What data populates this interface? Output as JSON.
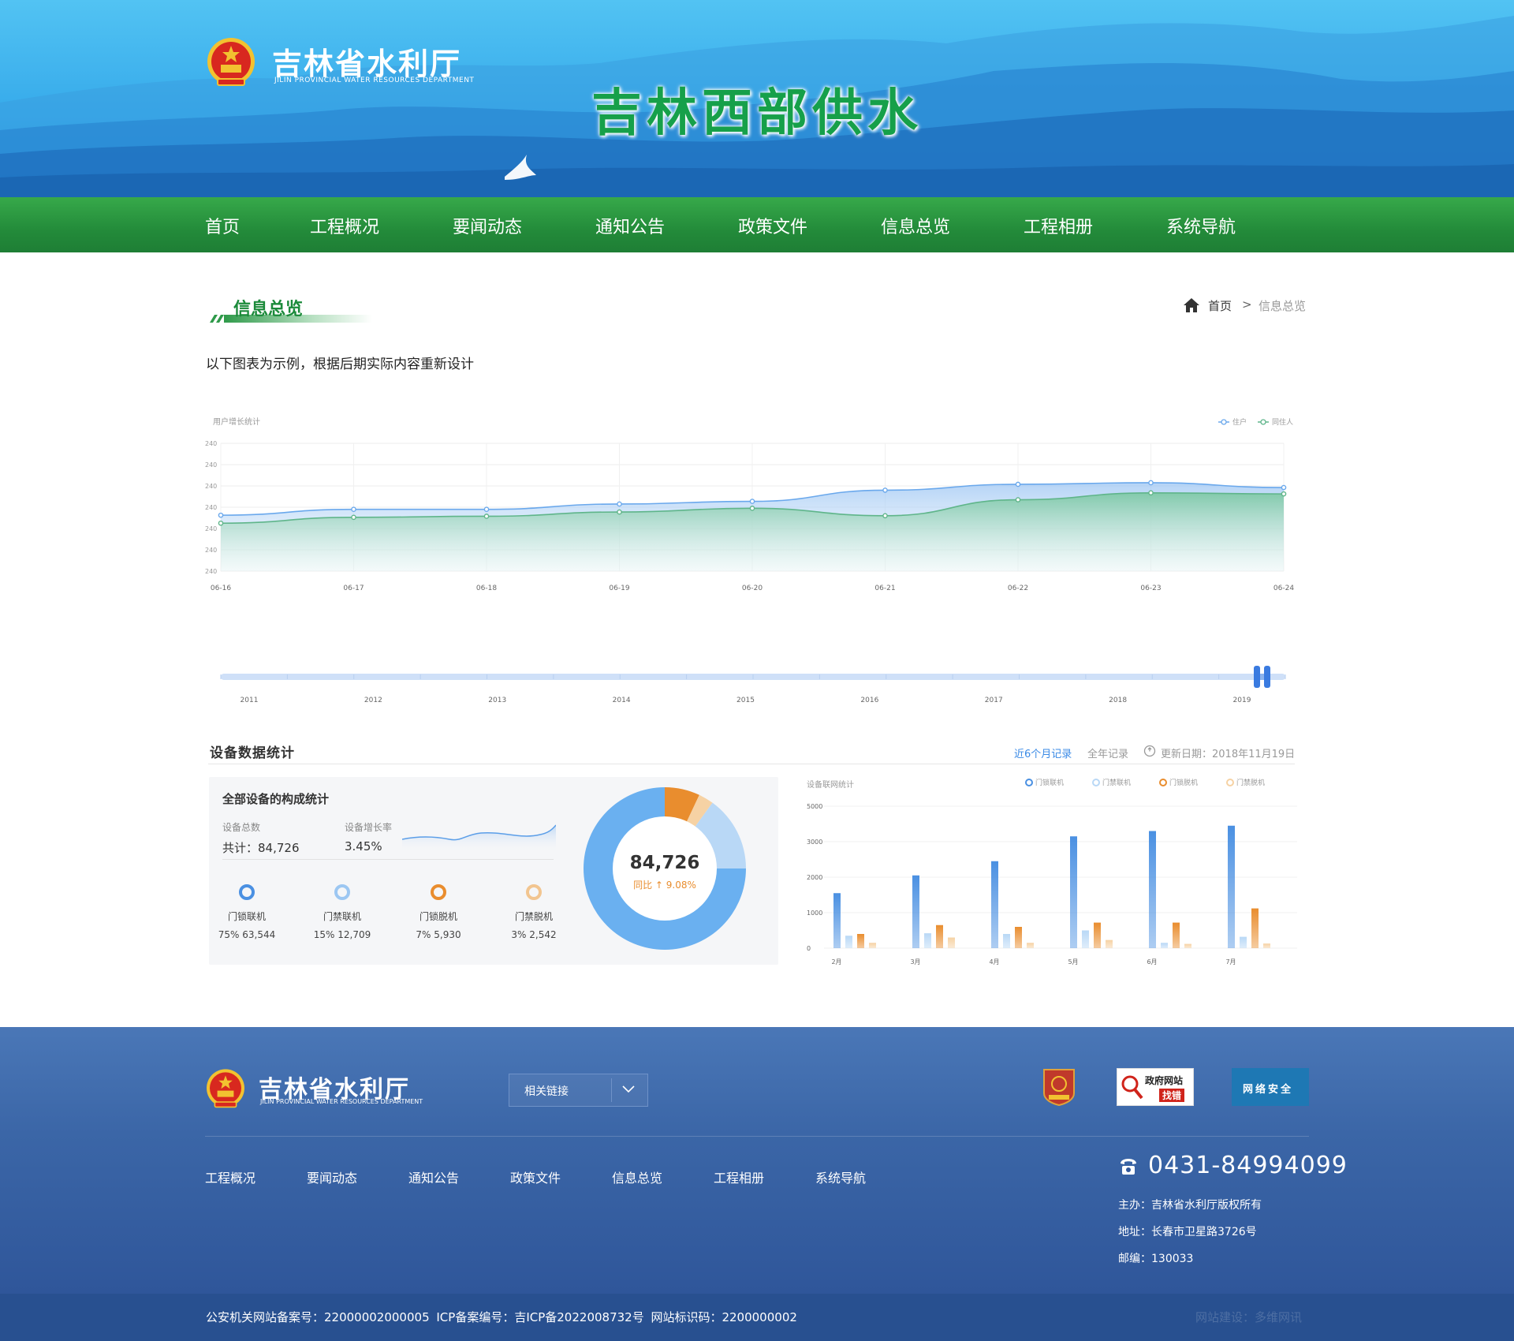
{
  "header": {
    "org_name": "吉林省水利厅",
    "org_name_en": "JILIN PROVINCIAL WATER RESOURCES DEPARTMENT",
    "site_title": "吉林西部供水"
  },
  "nav": {
    "items": [
      "首页",
      "工程概况",
      "要闻动态",
      "通知公告",
      "政策文件",
      "信息总览",
      "工程相册",
      "系统导航"
    ]
  },
  "page": {
    "section_title": "信息总览",
    "breadcrumb": {
      "home": "首页",
      "separator": ">",
      "current": "信息总览"
    },
    "intro": "以下图表为示例，根据后期实际内容重新设计"
  },
  "device_section": {
    "title": "设备数据统计",
    "tab_recent": "近6个月记录",
    "tab_year": "全年记录",
    "update_label": "更新日期：2018年11月19日",
    "card_title": "全部设备的构成统计",
    "total_label": "设备总数",
    "total_value": "共计：84,726",
    "growth_label": "设备增长率",
    "growth_value": "3.45%",
    "devices": [
      {
        "name": "门锁联机",
        "value": "75% 63,544",
        "color": "#4a90e2"
      },
      {
        "name": "门禁联机",
        "value": "15% 12,709",
        "color": "#9cc7f2"
      },
      {
        "name": "门锁脱机",
        "value": "7% 5,930",
        "color": "#e98d2e"
      },
      {
        "name": "门禁脱机",
        "value": "3% 2,542",
        "color": "#f2c590"
      }
    ],
    "donut_total": "84,726",
    "donut_sub": "同比 ↑ 9.08%"
  },
  "chart_data": [
    {
      "type": "area",
      "title": "用户增长统计",
      "categories": [
        "06-16",
        "06-17",
        "06-18",
        "06-19",
        "06-20",
        "06-21",
        "06-22",
        "06-23",
        "06-24"
      ],
      "y_tick_labels": [
        "240",
        "240",
        "240",
        "240",
        "240",
        "240",
        "240"
      ],
      "legend_placement": "top-right",
      "grid": true,
      "series": [
        {
          "name": "住户",
          "values": [
            5.25,
            5.8,
            5.8,
            6.3,
            6.55,
            7.6,
            8.15,
            8.3,
            7.85
          ],
          "color": "#6aa8ec"
        },
        {
          "name": "同住人",
          "values": [
            4.5,
            5.05,
            5.15,
            5.55,
            5.9,
            5.2,
            6.7,
            7.35,
            7.25
          ],
          "color": "#5fb58a"
        }
      ],
      "ylim": [
        0,
        12
      ]
    },
    {
      "type": "range-slider",
      "categories": [
        "2011",
        "2012",
        "2013",
        "2014",
        "2015",
        "2016",
        "2017",
        "2018",
        "2019"
      ],
      "selected_range": [
        2019,
        2019
      ]
    },
    {
      "type": "pie",
      "categories": [
        "门锁联机",
        "门禁联机",
        "门锁脱机",
        "门禁脱机"
      ],
      "values": [
        75,
        15,
        7,
        3
      ],
      "colors": [
        "#6ab0f0",
        "#b9d8f6",
        "#e98d2e",
        "#f6d2a4"
      ],
      "center_text": "84,726"
    },
    {
      "type": "bar",
      "title": "设备联网统计",
      "categories": [
        "2月",
        "3月",
        "4月",
        "5月",
        "6月",
        "7月"
      ],
      "y_tick_labels": [
        "5000",
        "3000",
        "2000",
        "1000",
        "0"
      ],
      "ylim": [
        0,
        4000
      ],
      "legend_placement": "top-right",
      "series": [
        {
          "name": "门锁联机",
          "values": [
            1550,
            2050,
            2450,
            3150,
            3300,
            3450
          ],
          "color": "#4a90e2"
        },
        {
          "name": "门禁联机",
          "values": [
            350,
            420,
            400,
            500,
            150,
            320
          ],
          "color": "#b9d8f6"
        },
        {
          "name": "门锁脱机",
          "values": [
            400,
            650,
            600,
            720,
            720,
            1120
          ],
          "color": "#e98d2e"
        },
        {
          "name": "门禁脱机",
          "values": [
            150,
            300,
            150,
            230,
            120,
            130
          ],
          "color": "#f6d2a4"
        }
      ]
    }
  ],
  "footer": {
    "org_name": "吉林省水利厅",
    "org_name_en": "JILIN PROVINCIAL WATER RESOURCES DEPARTMENT",
    "related_links_label": "相关链接",
    "badge_find_line1": "政府网站",
    "badge_find_line2": "找错",
    "badge_security": "网络安全",
    "links": [
      "工程概况",
      "要闻动态",
      "通知公告",
      "政策文件",
      "信息总览",
      "工程相册",
      "系统导航"
    ],
    "phone": "0431-84994099",
    "sponsor": "主办：吉林省水利厅版权所有",
    "address": "地址：长春市卫星路3726号",
    "postcode": "邮编：130033",
    "record": "公安机关网站备案号：22000002000005 ICP备案编号：吉ICP备2022008732号 网站标识码：2200000002",
    "builder": "网站建设：多维网讯"
  }
}
